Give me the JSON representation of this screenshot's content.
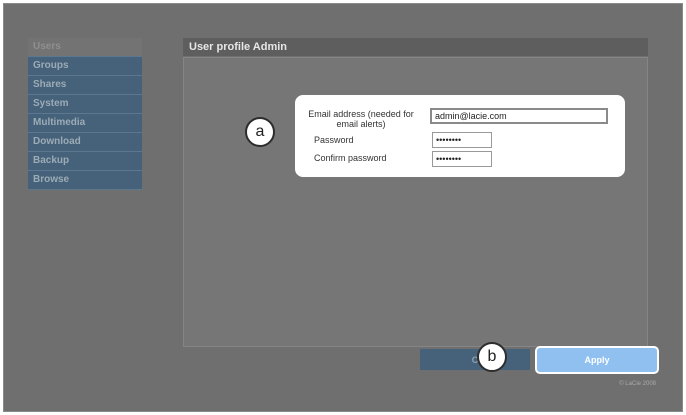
{
  "sidebar": {
    "items": [
      {
        "label": "Users"
      },
      {
        "label": "Groups"
      },
      {
        "label": "Shares"
      },
      {
        "label": "System"
      },
      {
        "label": "Multimedia"
      },
      {
        "label": "Download"
      },
      {
        "label": "Backup"
      },
      {
        "label": "Browse"
      }
    ]
  },
  "main": {
    "title": "User profile Admin"
  },
  "form": {
    "email_label": "Email address (needed for email alerts)",
    "email_value": "admin@lacie.com",
    "password_label": "Password",
    "password_value": "••••••••",
    "confirm_label": "Confirm password",
    "confirm_value": "••••••••"
  },
  "callouts": {
    "a": "a",
    "b": "b"
  },
  "buttons": {
    "cancel_label": "C",
    "apply_label": "Apply"
  },
  "footer": {
    "copyright": "© LaCie 2008"
  },
  "colors": {
    "nav_bg": "#45627a",
    "apply_bg": "#8fc0f0",
    "overlay": "#6f6f6f"
  }
}
